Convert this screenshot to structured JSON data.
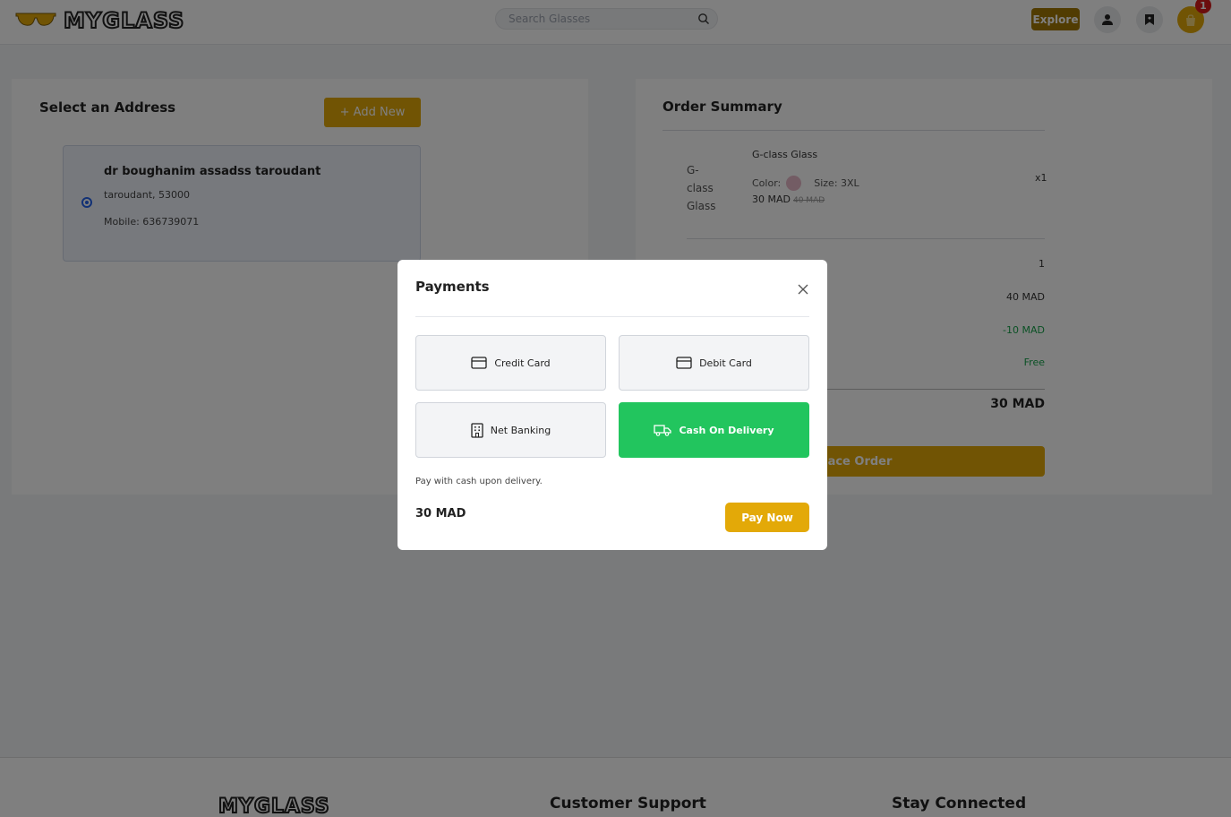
{
  "header": {
    "logo_text": "MYGLASS",
    "search_placeholder": "Search Glasses",
    "explore_label": "Explore",
    "cart_count": "1"
  },
  "address": {
    "title": "Select an Address",
    "add_new_label": "+ Add New",
    "name": "dr boughanim assadss taroudant",
    "city_line": "taroudant, 53000",
    "mobile_line": "Mobile: 636739071"
  },
  "order": {
    "title": "Order Summary",
    "product_image_alt": "G-class Glass",
    "product_name": "G-class Glass",
    "color_label": "Color:",
    "size_label": "Size: 3XL",
    "price": "30 MAD",
    "original_price": "40 MAD",
    "quantity": "x1",
    "items_value": "1",
    "subtotal_value": "40 MAD",
    "discount_value": "-10 MAD",
    "shipping_value": "Free",
    "total_value": "30 MAD",
    "place_order_label": "Place Order"
  },
  "footer": {
    "logo_text": "MYGLASS",
    "support_heading": "Customer Support",
    "connected_heading": "Stay Connected"
  },
  "modal": {
    "title": "Payments",
    "options": [
      {
        "label": "Credit Card",
        "icon": "credit-card-icon"
      },
      {
        "label": "Debit Card",
        "icon": "credit-card-icon"
      },
      {
        "label": "Net Banking",
        "icon": "building-icon"
      },
      {
        "label": "Cash On Delivery",
        "icon": "truck-icon",
        "selected": true
      }
    ],
    "description": "Pay with cash upon delivery.",
    "amount": "30 MAD",
    "pay_now_label": "Pay Now"
  },
  "colors": {
    "brand": "#e3a908",
    "explore": "#a37804",
    "selected_option": "#22c55e",
    "discount": "#16a34a",
    "badge": "#d71a1a"
  }
}
